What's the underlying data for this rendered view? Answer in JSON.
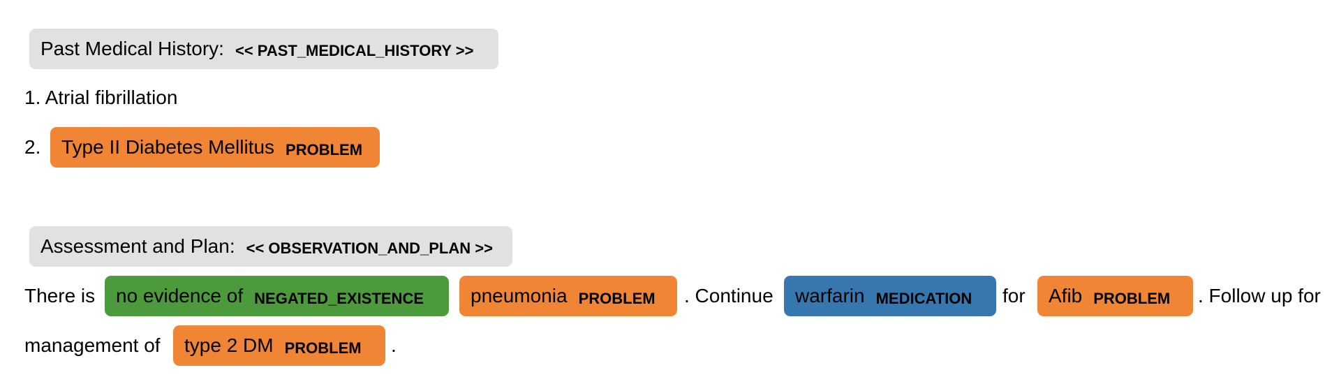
{
  "sections": [
    {
      "title": "Past Medical History:",
      "tag": "<< PAST_MEDICAL_HISTORY >>"
    },
    {
      "title": "Assessment and Plan:",
      "tag": "<< OBSERVATION_AND_PLAN >>"
    }
  ],
  "history": {
    "item1": "1. Atrial fibrillation",
    "item2_num": "2.",
    "item2_entity": {
      "text": "Type II Diabetes Mellitus",
      "label": "PROBLEM"
    }
  },
  "plan": {
    "t1": "There is",
    "e1": {
      "text": "no evidence of",
      "label": "NEGATED_EXISTENCE"
    },
    "e2": {
      "text": "pneumonia",
      "label": "PROBLEM"
    },
    "t2": ". Continue",
    "e3": {
      "text": "warfarin",
      "label": "MEDICATION"
    },
    "t3": "for",
    "e4": {
      "text": "Afib",
      "label": "PROBLEM"
    },
    "t4": ". Follow up for",
    "t5": "management of",
    "e5": {
      "text": "type 2 DM",
      "label": "PROBLEM"
    },
    "t6": "."
  },
  "colors": {
    "PROBLEM": "#f08535",
    "MEDICATION": "#3777b0",
    "NEGATED_EXISTENCE": "#4d9a3c",
    "section": "#e1e1e4"
  }
}
